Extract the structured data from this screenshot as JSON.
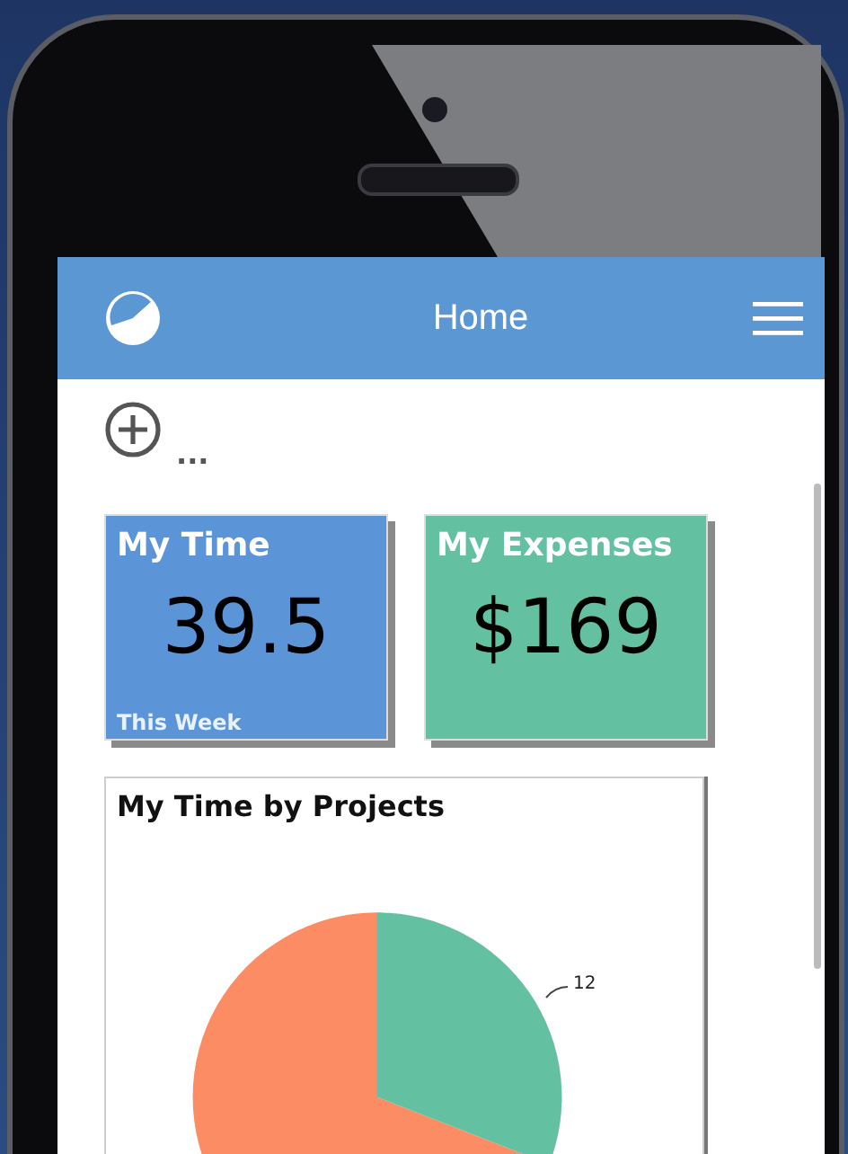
{
  "header": {
    "title": "Home"
  },
  "toolbar": {
    "more_label": "..."
  },
  "tiles": [
    {
      "title": "My Time",
      "value": "39.5",
      "caption": "This Week",
      "color": "#5b95d8"
    },
    {
      "title": "My Expenses",
      "value": "$169",
      "color": "#63c1a2"
    }
  ],
  "chart_card": {
    "title": "My Time by Projects",
    "slice_label": "12"
  }
}
